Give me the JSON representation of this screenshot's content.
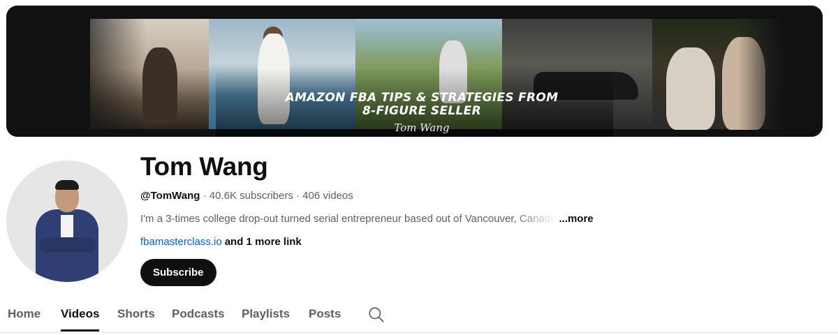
{
  "banner": {
    "headline_line1": "Amazon FBA Tips & Strategies From",
    "headline_line2": "8-Figure Seller",
    "signature": "Tom Wang"
  },
  "channel": {
    "name": "Tom Wang",
    "handle": "@TomWang",
    "subscribers": "40.6K subscribers",
    "videos": "406 videos",
    "separator": " · ",
    "description": "I'm a 3-times college drop-out turned serial entrepreneur based out of Vancouver, Canada",
    "more_label": "...more",
    "link_text": "fbamasterclass.io",
    "extra_links": "and 1 more link",
    "subscribe_label": "Subscribe"
  },
  "tabs": {
    "home": "Home",
    "videos": "Videos",
    "shorts": "Shorts",
    "podcasts": "Podcasts",
    "playlists": "Playlists",
    "posts": "Posts",
    "active": "Videos"
  },
  "icons": {
    "search": "search-icon"
  },
  "colors": {
    "link": "#065fd4",
    "subscribe_bg": "#0f0f0f",
    "text_secondary": "#606060"
  }
}
